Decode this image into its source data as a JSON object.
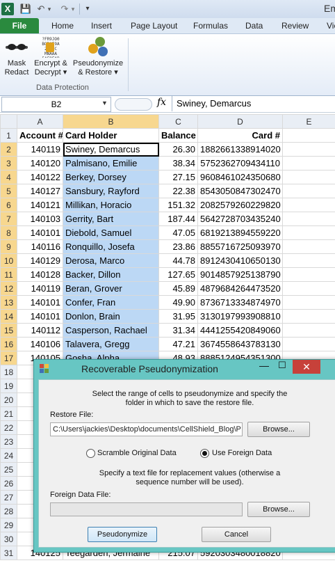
{
  "app": {
    "window_title_fragment": "Em"
  },
  "quick_access": {
    "excel_logo": "X",
    "save_icon": "💾",
    "undo_icon": "↶",
    "redo_icon": "↷",
    "dropdown": "▾",
    "customize": "▾"
  },
  "tabs": [
    "File",
    "Home",
    "Insert",
    "Page Layout",
    "Formulas",
    "Data",
    "Review",
    "Vie"
  ],
  "ribbon": {
    "buttons": [
      {
        "line1": "Mask",
        "line2": "Redact"
      },
      {
        "line1": "Encrypt &",
        "line2": "Decrypt ▾"
      },
      {
        "line1": "Pseudonymize",
        "line2": "& Restore ▾"
      }
    ],
    "encrypt_icon_text": "?FR9JO0 BODAE9A 2B83C MNAAA 5AF8FAB",
    "group_label": "Data Protection"
  },
  "formula_bar": {
    "name_box": "B2",
    "fx": "fx",
    "value": "Swiney, Demarcus"
  },
  "sheet": {
    "columns": [
      "A",
      "B",
      "C",
      "D",
      "E"
    ],
    "headers": [
      "Account #",
      "Card Holder",
      "Balance",
      "Card #"
    ],
    "rows": [
      [
        "140119",
        "Swiney, Demarcus",
        "26.30",
        "1882661338914020"
      ],
      [
        "140120",
        "Palmisano, Emilie",
        "38.34",
        "5752362709434110"
      ],
      [
        "140122",
        "Berkey, Dorsey",
        "27.15",
        "9608461024350680"
      ],
      [
        "140127",
        "Sansbury, Rayford",
        "22.38",
        "8543050847302470"
      ],
      [
        "140121",
        "Millikan, Horacio",
        "151.32",
        "2082579260229820"
      ],
      [
        "140103",
        "Gerrity, Bart",
        "187.44",
        "5642728703435240"
      ],
      [
        "140101",
        "Diebold, Samuel",
        "47.05",
        "6819213894559220"
      ],
      [
        "140116",
        "Ronquillo, Josefa",
        "23.86",
        "8855716725093970"
      ],
      [
        "140129",
        "Derosa, Marco",
        "44.78",
        "8912430410650130"
      ],
      [
        "140128",
        "Backer, Dillon",
        "127.65",
        "9014857925138790"
      ],
      [
        "140119",
        "Beran, Grover",
        "45.89",
        "4879684264473520"
      ],
      [
        "140101",
        "Confer, Fran",
        "49.90",
        "8736713334874970"
      ],
      [
        "140101",
        "Donlon, Brain",
        "31.95",
        "3130197993908810"
      ],
      [
        "140112",
        "Casperson, Rachael",
        "31.34",
        "4441255420849060"
      ],
      [
        "140106",
        "Talavera, Gregg",
        "47.21",
        "3674558643783130"
      ],
      [
        "140105",
        "Gosha, Alpha",
        "48.93",
        "8885124954351300"
      ],
      [
        "",
        "",
        "",
        ""
      ],
      [
        "",
        "",
        "",
        ""
      ],
      [
        "",
        "",
        "",
        ""
      ],
      [
        "",
        "",
        "",
        ""
      ],
      [
        "",
        "",
        "",
        ""
      ],
      [
        "",
        "",
        "",
        ""
      ],
      [
        "",
        "",
        "",
        ""
      ],
      [
        "",
        "",
        "",
        ""
      ],
      [
        "",
        "",
        "",
        ""
      ],
      [
        "",
        "",
        "",
        ""
      ],
      [
        "",
        "",
        "",
        ""
      ],
      [
        "",
        "",
        "",
        ""
      ],
      [
        "",
        "",
        "",
        ""
      ],
      [
        "140125",
        "Teegarden, Jermaine",
        "215.07",
        "5920303480018820"
      ]
    ]
  },
  "dialog": {
    "title": "Recoverable Pseudonymization",
    "min": "—",
    "max": "☐",
    "close": "✕",
    "intro_line1": "Select the range of cells to pseudonymize and specify the",
    "intro_line2": "folder in which to save the restore file.",
    "restore_label": "Restore File:",
    "restore_path": "C:\\Users\\jackies\\Desktop\\documents\\CellShield_Blog\\P",
    "browse": "Browse...",
    "radio_scramble": "Scramble Original Data",
    "radio_foreign": "Use Foreign Data",
    "foreign_hint1": "Specify a text file for replacement values (otherwise a",
    "foreign_hint2": "sequence number will be used).",
    "foreign_label": "Foreign Data File:",
    "foreign_path": "",
    "browse2": "Browse...",
    "ok": "Pseudonymize",
    "cancel": "Cancel"
  }
}
